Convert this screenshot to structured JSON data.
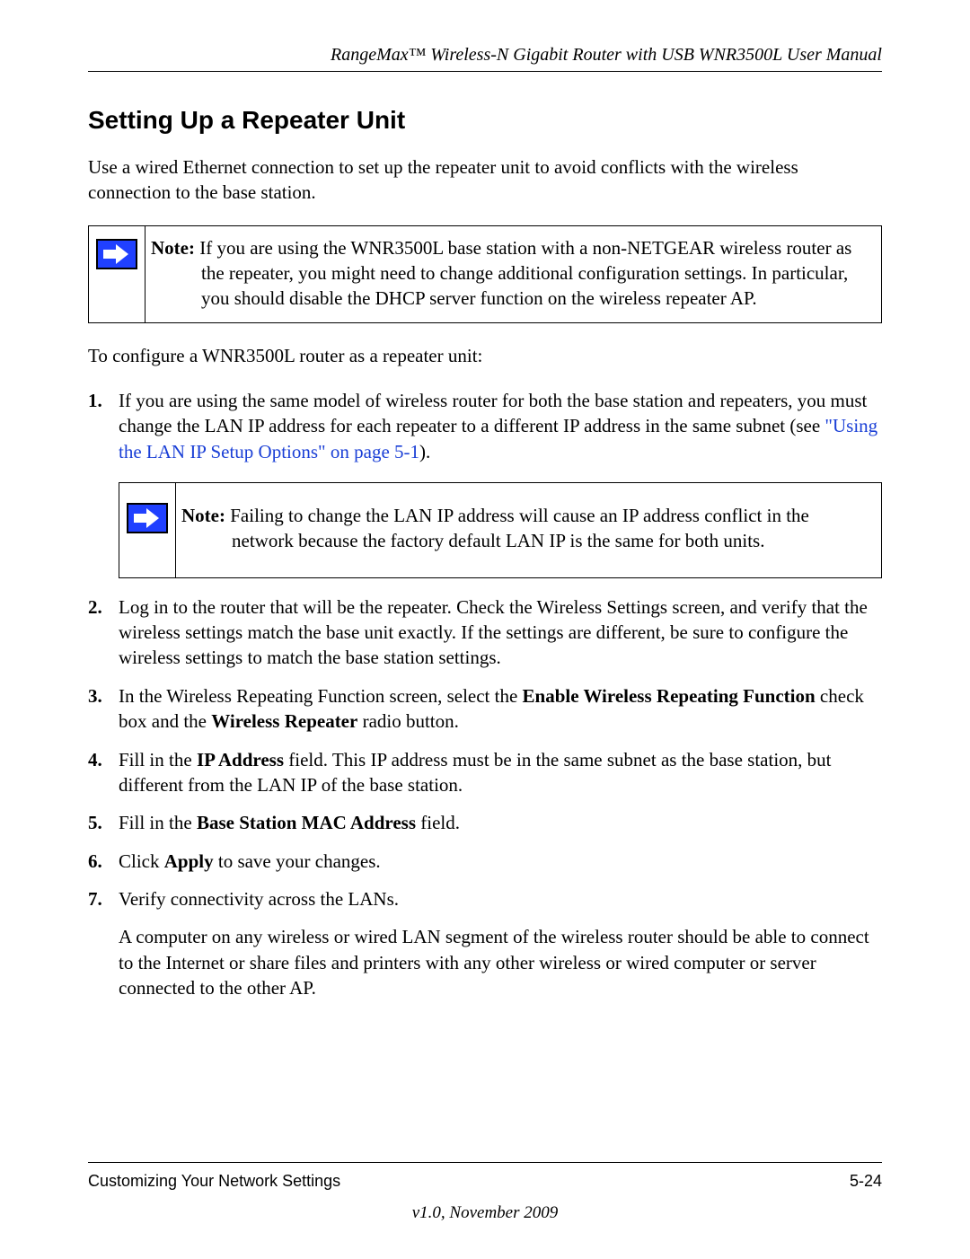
{
  "header": "RangeMax™ Wireless-N Gigabit Router with USB WNR3500L User Manual",
  "heading": "Setting Up a Repeater Unit",
  "intro": "Use a wired Ethernet connection to set up the repeater unit to avoid conflicts with the wireless connection to the base station.",
  "note1": {
    "label": "Note:",
    "text": "If you are using the WNR3500L base station with a non-NETGEAR wireless router as the repeater, you might need to change additional configuration settings. In particular, you should disable the DHCP server function on the wireless repeater AP."
  },
  "lead": "To configure a WNR3500L router as a repeater unit:",
  "steps": {
    "s1a": "If you are using the same model of wireless router for both the base station and repeaters, you must change the LAN IP address for each repeater to a different IP address in the same subnet (see ",
    "s1link": "\"Using the LAN IP Setup Options\" on page 5-1",
    "s1b": ").",
    "note2label": "Note:",
    "note2text": "Failing to change the LAN IP address will cause an IP address conflict in the network because the factory default LAN IP is the same for both units.",
    "s2": "Log in to the router that will be the repeater. Check the Wireless Settings screen, and verify that the wireless settings match the base unit exactly. If the settings are different, be sure to configure the wireless settings to match the base station settings.",
    "s3a": "In the Wireless Repeating Function screen, select the ",
    "s3b": "Enable Wireless Repeating Function",
    "s3c": " check box and the ",
    "s3d": "Wireless Repeater",
    "s3e": " radio button.",
    "s4a": "Fill in the ",
    "s4b": "IP Address",
    "s4c": " field. This IP address must be in the same subnet as the base station, but different from the LAN IP of the base station.",
    "s5a": "Fill in the ",
    "s5b": "Base Station MAC Address",
    "s5c": " field.",
    "s6a": "Click ",
    "s6b": "Apply",
    "s6c": " to save your changes.",
    "s7": "Verify connectivity across the LANs.",
    "s7sub": "A computer on any wireless or wired LAN segment of the wireless router should be able to connect to the Internet or share files and printers with any other wireless or wired computer or server connected to the other AP."
  },
  "footer": {
    "left": "Customizing Your Network Settings",
    "right": "5-24",
    "version": "v1.0, November 2009"
  }
}
